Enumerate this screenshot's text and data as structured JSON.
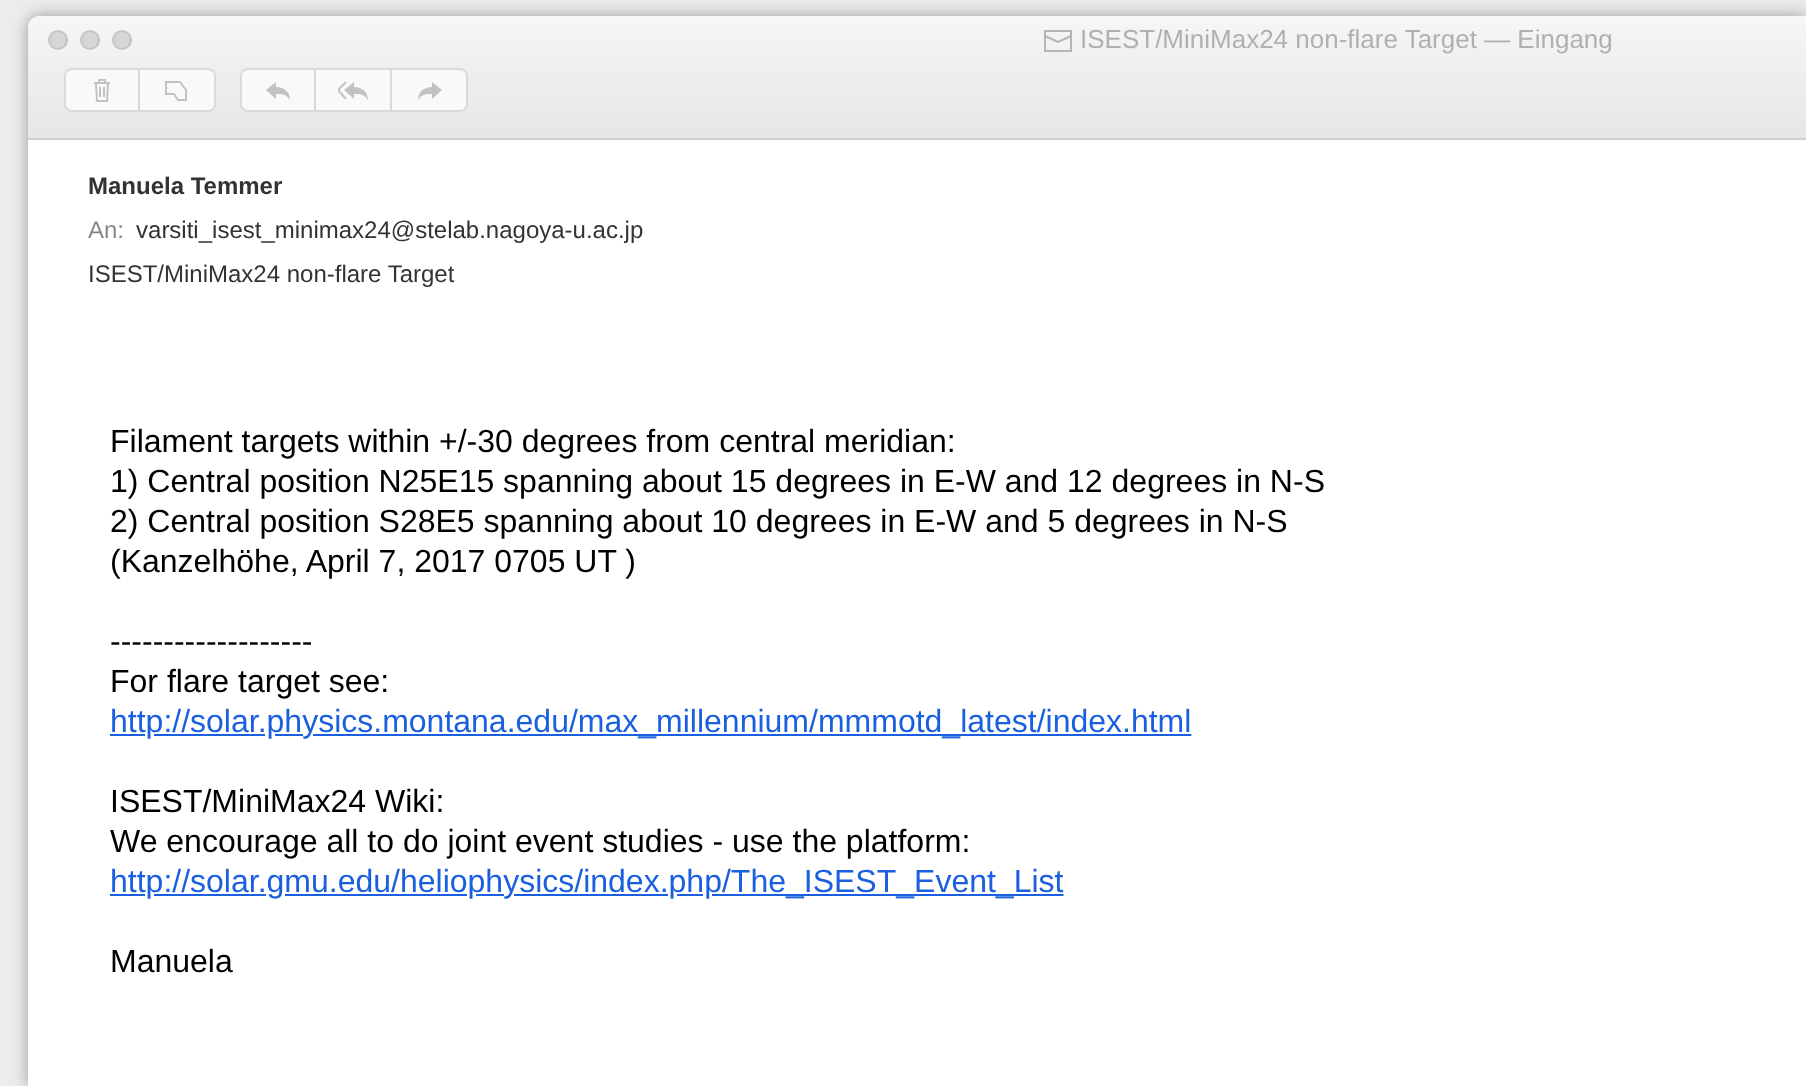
{
  "window": {
    "title": "ISEST/MiniMax24 non-flare Target — Eingang"
  },
  "header": {
    "from": "Manuela Temmer",
    "to_label": "An:",
    "to": "varsiti_isest_minimax24@stelab.nagoya-u.ac.jp",
    "subject": "ISEST/MiniMax24 non-flare Target"
  },
  "body": [
    {
      "kind": "text",
      "text": "Filament targets within +/-30 degrees from central meridian:"
    },
    {
      "kind": "text",
      "text": "1) Central position N25E15 spanning about 15 degrees in E-W and 12 degrees in N-S"
    },
    {
      "kind": "text",
      "text": "2) Central position S28E5 spanning about 10 degrees in E-W and 5 degrees in N-S"
    },
    {
      "kind": "text",
      "text": "(Kanzelhöhe, April 7, 2017 0705 UT )"
    },
    {
      "kind": "gap"
    },
    {
      "kind": "text",
      "text": "-------------------"
    },
    {
      "kind": "text",
      "text": "For flare target see:"
    },
    {
      "kind": "link",
      "text": "http://solar.physics.montana.edu/max_millennium/mmmotd_latest/index.html"
    },
    {
      "kind": "gap"
    },
    {
      "kind": "text",
      "text": "ISEST/MiniMax24 Wiki:"
    },
    {
      "kind": "text",
      "text": "We encourage all to do joint event studies - use the platform:"
    },
    {
      "kind": "link",
      "text": "http://solar.gmu.edu/heliophysics/index.php/The_ISEST_Event_List"
    },
    {
      "kind": "gap"
    },
    {
      "kind": "text",
      "text": "Manuela"
    }
  ]
}
